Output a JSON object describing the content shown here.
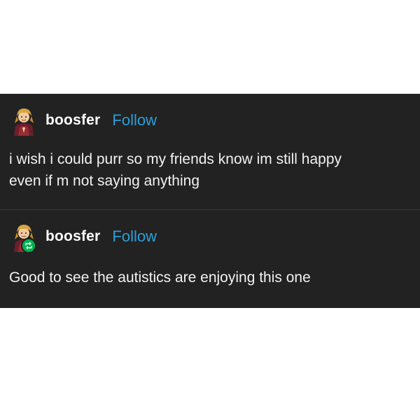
{
  "posts": [
    {
      "username": "boosfer",
      "follow_label": "Follow",
      "text_lines": [
        "i wish i could purr so my friends know im still happy",
        "even if m not saying anything"
      ],
      "avatar_icon": "character-avatar-icon"
    },
    {
      "username": "boosfer",
      "follow_label": "Follow",
      "text_lines": [
        "Good to see the autistics are enjoying this one"
      ],
      "avatar_icon": "character-avatar-icon",
      "badge_icon": "reblog-icon",
      "badge_color": "#00b34d"
    }
  ],
  "colors": {
    "card_background": "#222222",
    "follow_link": "#2a9fd8",
    "text": "#f2f2f2"
  }
}
